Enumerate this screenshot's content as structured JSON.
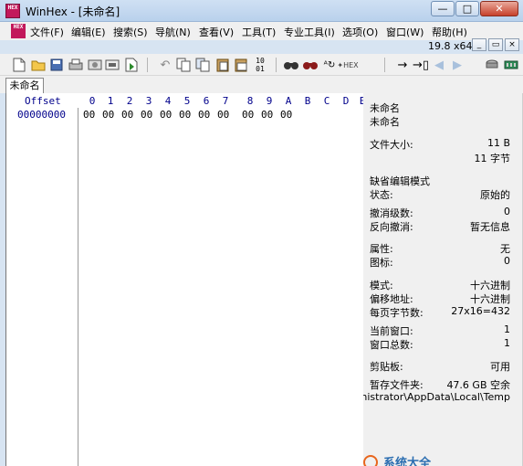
{
  "app": {
    "icon_text": "HEX",
    "title": "WinHex - [未命名]",
    "version": "19.8 x64"
  },
  "window_buttons": {
    "minimize": "—",
    "maximize": "□",
    "close": "✕"
  },
  "mdi_buttons": {
    "minimize": "_",
    "restore": "▭",
    "close": "×"
  },
  "menu": [
    "文件(F)",
    "编辑(E)",
    "搜索(S)",
    "导航(N)",
    "查看(V)",
    "工具(T)",
    "专业工具(I)",
    "选项(O)",
    "窗口(W)",
    "帮助(H)"
  ],
  "toolbar_icons": [
    "new-file-icon",
    "open-file-icon",
    "save-icon",
    "print-icon",
    "properties-icon",
    "open-disk-icon",
    "execute-icon",
    "undo-icon",
    "copy-icon",
    "copy-block-icon",
    "paste-icon",
    "paste-write-icon",
    "convert-icon",
    "find-text-icon",
    "find-hex-icon",
    "replace-text-icon",
    "replace-hex-icon",
    "goto-offset-icon",
    "goto-sector-icon",
    "back-icon",
    "forward-icon",
    "disk-icon",
    "ram-icon"
  ],
  "tab": {
    "label": "未命名"
  },
  "hex": {
    "offset_header": "Offset",
    "columns": [
      "0",
      "1",
      "2",
      "3",
      "4",
      "5",
      "6",
      "7",
      "8",
      "9",
      "A",
      "B",
      "C",
      "D",
      "E"
    ],
    "rows": [
      {
        "offset": "00000000",
        "bytes": [
          "00",
          "00",
          "00",
          "00",
          "00",
          "00",
          "00",
          "00",
          "00",
          "00",
          "00"
        ]
      }
    ]
  },
  "info_panel": {
    "name1": "未命名",
    "name2": "未命名",
    "file_size_label": "文件大小:",
    "file_size_value": "11 B",
    "file_size_bytes": "11 字节",
    "default_edit_mode_label": "缺省编辑模式",
    "state_label": "状态:",
    "state_value": "原始的",
    "undo_level_label": "撤消级数:",
    "undo_level_value": "0",
    "reverse_undo_label": "反向撤消:",
    "reverse_undo_value": "暂无信息",
    "attribute_label": "属性:",
    "attribute_value": "无",
    "icon_label": "图标:",
    "icon_value": "0",
    "mode_label": "模式:",
    "mode_value": "十六进制",
    "offset_addr_label": "偏移地址:",
    "offset_addr_value": "十六进制",
    "bytes_per_page_label": "每页字节数:",
    "bytes_per_page_value": "27x16=432",
    "current_window_label": "当前窗口:",
    "current_window_value": "1",
    "window_total_label": "窗口总数:",
    "window_total_value": "1",
    "clipboard_label": "剪贴板:",
    "clipboard_value": "可用",
    "temp_folder_label": "暂存文件夹:",
    "temp_folder_value": "47.6 GB 空余",
    "temp_folder_path": "inistrator\\AppData\\Local\\Temp"
  },
  "watermark": {
    "text": "系统大全"
  }
}
